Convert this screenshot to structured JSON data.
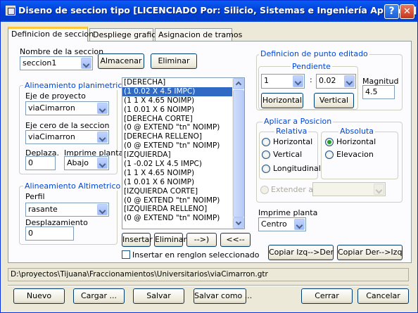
{
  "window": {
    "title": "Diseno de seccion tipo  [LICENCIADO Por: Silicio, Sistemas e Ingeniería Aplicada]",
    "help_label": "?",
    "close_label": "✕"
  },
  "tabs": [
    {
      "label": "Definicion de seccion"
    },
    {
      "label": "Despliege grafico"
    },
    {
      "label": "Asignacion de tramos"
    }
  ],
  "nombre": {
    "label": "Nombre de la seccion",
    "value": "seccion1",
    "almacenar": "Almacenar",
    "eliminar": "Eliminar"
  },
  "planimetrico": {
    "title": "Alineamiento planimetrico",
    "eje_proyecto_label": "Eje de proyecto",
    "eje_proyecto_value": "viaCimarron",
    "eje_cero_label": "Eje cero de la seccion",
    "eje_cero_value": "viaCimarron",
    "deplaza_label": "Deplaza.",
    "deplaza_value": "0",
    "imprime_label": "Imprime planta",
    "imprime_value": "Abajo"
  },
  "altimetrico": {
    "title": "Alineamiento Altimetrico",
    "perfil_label": "Perfil",
    "perfil_value": "rasante",
    "desplazamiento_label": "Desplazamiento",
    "desplazamiento_value": "0"
  },
  "lista": {
    "items": [
      "[DERECHA]",
      "(1 0.02 X 4.5 IMPC)",
      "(1 1 X 4.65 NOIMP)",
      "(1 0.01 X 6 NOIMP)",
      "[DERECHA CORTE]",
      "(0 @ EXTEND \"tn\" NOIMP)",
      "[DERECHA RELLENO]",
      "(0 @ EXTEND \"tn\" NOIMP)",
      "[IZQUIERDA]",
      "(1 -0.02 LX 4.5 IMPC)",
      "(1 1 X 4.65 NOIMP)",
      "(1 0.01 X 6 NOIMP)",
      "[IZQUIERDA CORTE]",
      "(0 @ EXTEND \"tn\" NOIMP)",
      "[IZQUIERDA RELLENO]",
      "(0 @ EXTEND \"tn\" NOIMP)"
    ],
    "selected_index": 1
  },
  "list_buttons": {
    "insertar": "Insertar",
    "eliminar": "Eliminar",
    "next": "-->)",
    "prev": "<<--"
  },
  "insertar_renglon_label": "Insertar en renglon seleccionado",
  "punto_editado": {
    "title": "Definicion de punto editado",
    "pendiente_label": "Pendiente",
    "pend1_value": "1",
    "colon": ":",
    "pend2_value": "0.02",
    "magnitud_label": "Magnitud",
    "magnitud_value": "4.5",
    "horizontal_btn": "Horizontal",
    "vertical_btn": "Vertical"
  },
  "aplicar": {
    "title": "Aplicar a Posicion",
    "relativa_label": "Relativa",
    "absoluta_label": "Absoluta",
    "rel_horizontal": "Horizontal",
    "rel_vertical": "Vertical",
    "rel_longitudinal": "Longitudinal",
    "abs_horizontal": "Horizontal",
    "abs_elevacion": "Elevacion",
    "extender_label": "Extender a"
  },
  "imprime_planta": {
    "label": "Imprime planta",
    "value": "Centro"
  },
  "copy": {
    "izq_der": "Copiar Izq-->Der",
    "der_izq": "Copiar Der-->Izq"
  },
  "path": "D:\\proyectos\\Tijuana\\Fraccionamientos\\Universitarios\\viaCimarron.gtr",
  "bottom": {
    "nuevo": "Nuevo",
    "cargar": "Cargar ...",
    "salvar": "Salvar",
    "salvar_como": "Salvar como ...",
    "cerrar": "Cerrar",
    "cancelar": "Cancelar"
  }
}
